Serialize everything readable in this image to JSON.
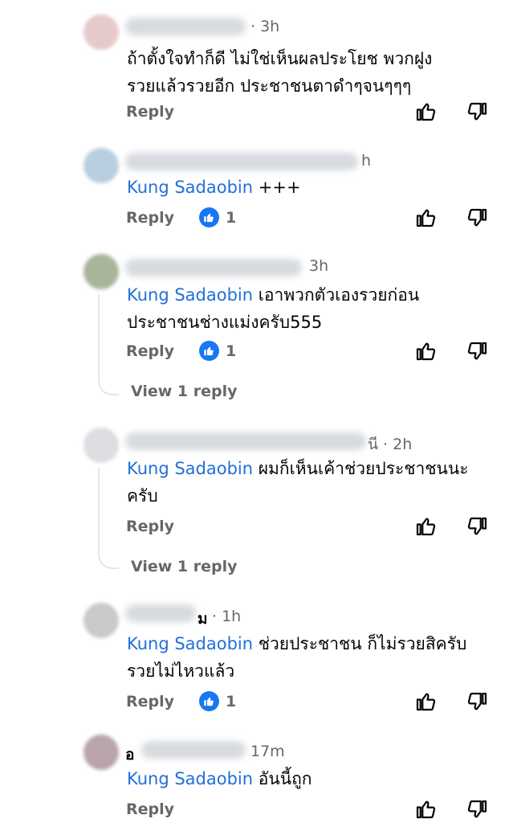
{
  "comments": [
    {
      "time": "· 3h",
      "text_plain": "ถ้าตั้งใจทำก็ดี ไม่ใช่เห็นผลประโยช พวกฝูง รวยแล้วรวยอีก ประชาชนตาดำๆจนๆๆๆ",
      "line1": "ถ้าตั้งใจทำก็ดี ไม่ใช่เห็นผลประโยช พวกฝูง",
      "line2": "รวยแล้วรวยอีก ประชาชนตาดำๆจนๆๆๆ",
      "reply_label": "Reply"
    },
    {
      "time": "h",
      "mention": "Kung Sadaobin",
      "text": " +++",
      "reply_label": "Reply",
      "reactions": "1"
    },
    {
      "time": "3h",
      "mention": "Kung Sadaobin",
      "line1": " เอาพวกตัวเองรวยก่อน",
      "line2": "ประชาชนช่างแม่งครับ555",
      "reply_label": "Reply",
      "reactions": "1",
      "view_replies": "View 1 reply"
    },
    {
      "time": "นี · 2h",
      "mention": "Kung Sadaobin",
      "line1": " ผมก็เห็นเค้าช่วยประชาชนนะ",
      "line2": "ครับ",
      "reply_label": "Reply",
      "view_replies": "View 1 reply"
    },
    {
      "name_partial": "ม",
      "time": "· 1h",
      "mention": "Kung Sadaobin",
      "line1": " ช่วยประชาชน ก็ไม่รวยสิครับ",
      "line2": "รวยไม่ไหวแล้ว",
      "reply_label": "Reply",
      "reactions": "1"
    },
    {
      "name_partial": "อ",
      "time": "17m",
      "mention": "Kung Sadaobin",
      "text": " อันนี้ถูก",
      "reply_label": "Reply"
    }
  ],
  "colors": {
    "mention": "#216fdb",
    "reaction": "#1877f2",
    "meta": "#65676b"
  },
  "icons": [
    "like-icon",
    "dislike-icon",
    "reaction-like-icon"
  ]
}
